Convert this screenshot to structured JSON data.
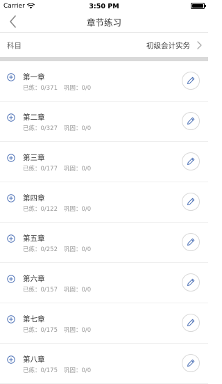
{
  "status_bar": {
    "carrier": "Carrier",
    "time": "3:50 PM"
  },
  "nav": {
    "title": "章节练习"
  },
  "subject": {
    "label": "科目",
    "value": "初级会计实务"
  },
  "stat_labels": {
    "practiced": "已练：",
    "consolidated": "巩固："
  },
  "chapters": [
    {
      "title": "第一章",
      "practiced": "0/371",
      "consolidated": "0/0"
    },
    {
      "title": "第二章",
      "practiced": "0/327",
      "consolidated": "0/0"
    },
    {
      "title": "第三章",
      "practiced": "0/177",
      "consolidated": "0/0"
    },
    {
      "title": "第四章",
      "practiced": "0/122",
      "consolidated": "0/0"
    },
    {
      "title": "第五章",
      "practiced": "0/252",
      "consolidated": "0/0"
    },
    {
      "title": "第六章",
      "practiced": "0/157",
      "consolidated": "0/0"
    },
    {
      "title": "第七章",
      "practiced": "0/175",
      "consolidated": "0/0"
    },
    {
      "title": "第八章",
      "practiced": "0/175",
      "consolidated": "0/0"
    }
  ],
  "colors": {
    "accent": "#4a6fb5",
    "divider": "#d9d9d9",
    "muted_text": "#999999"
  },
  "icons": {
    "back": "chevron-left-icon",
    "forward": "chevron-right-icon",
    "expand": "plus-circle-icon",
    "edit": "pencil-icon"
  }
}
